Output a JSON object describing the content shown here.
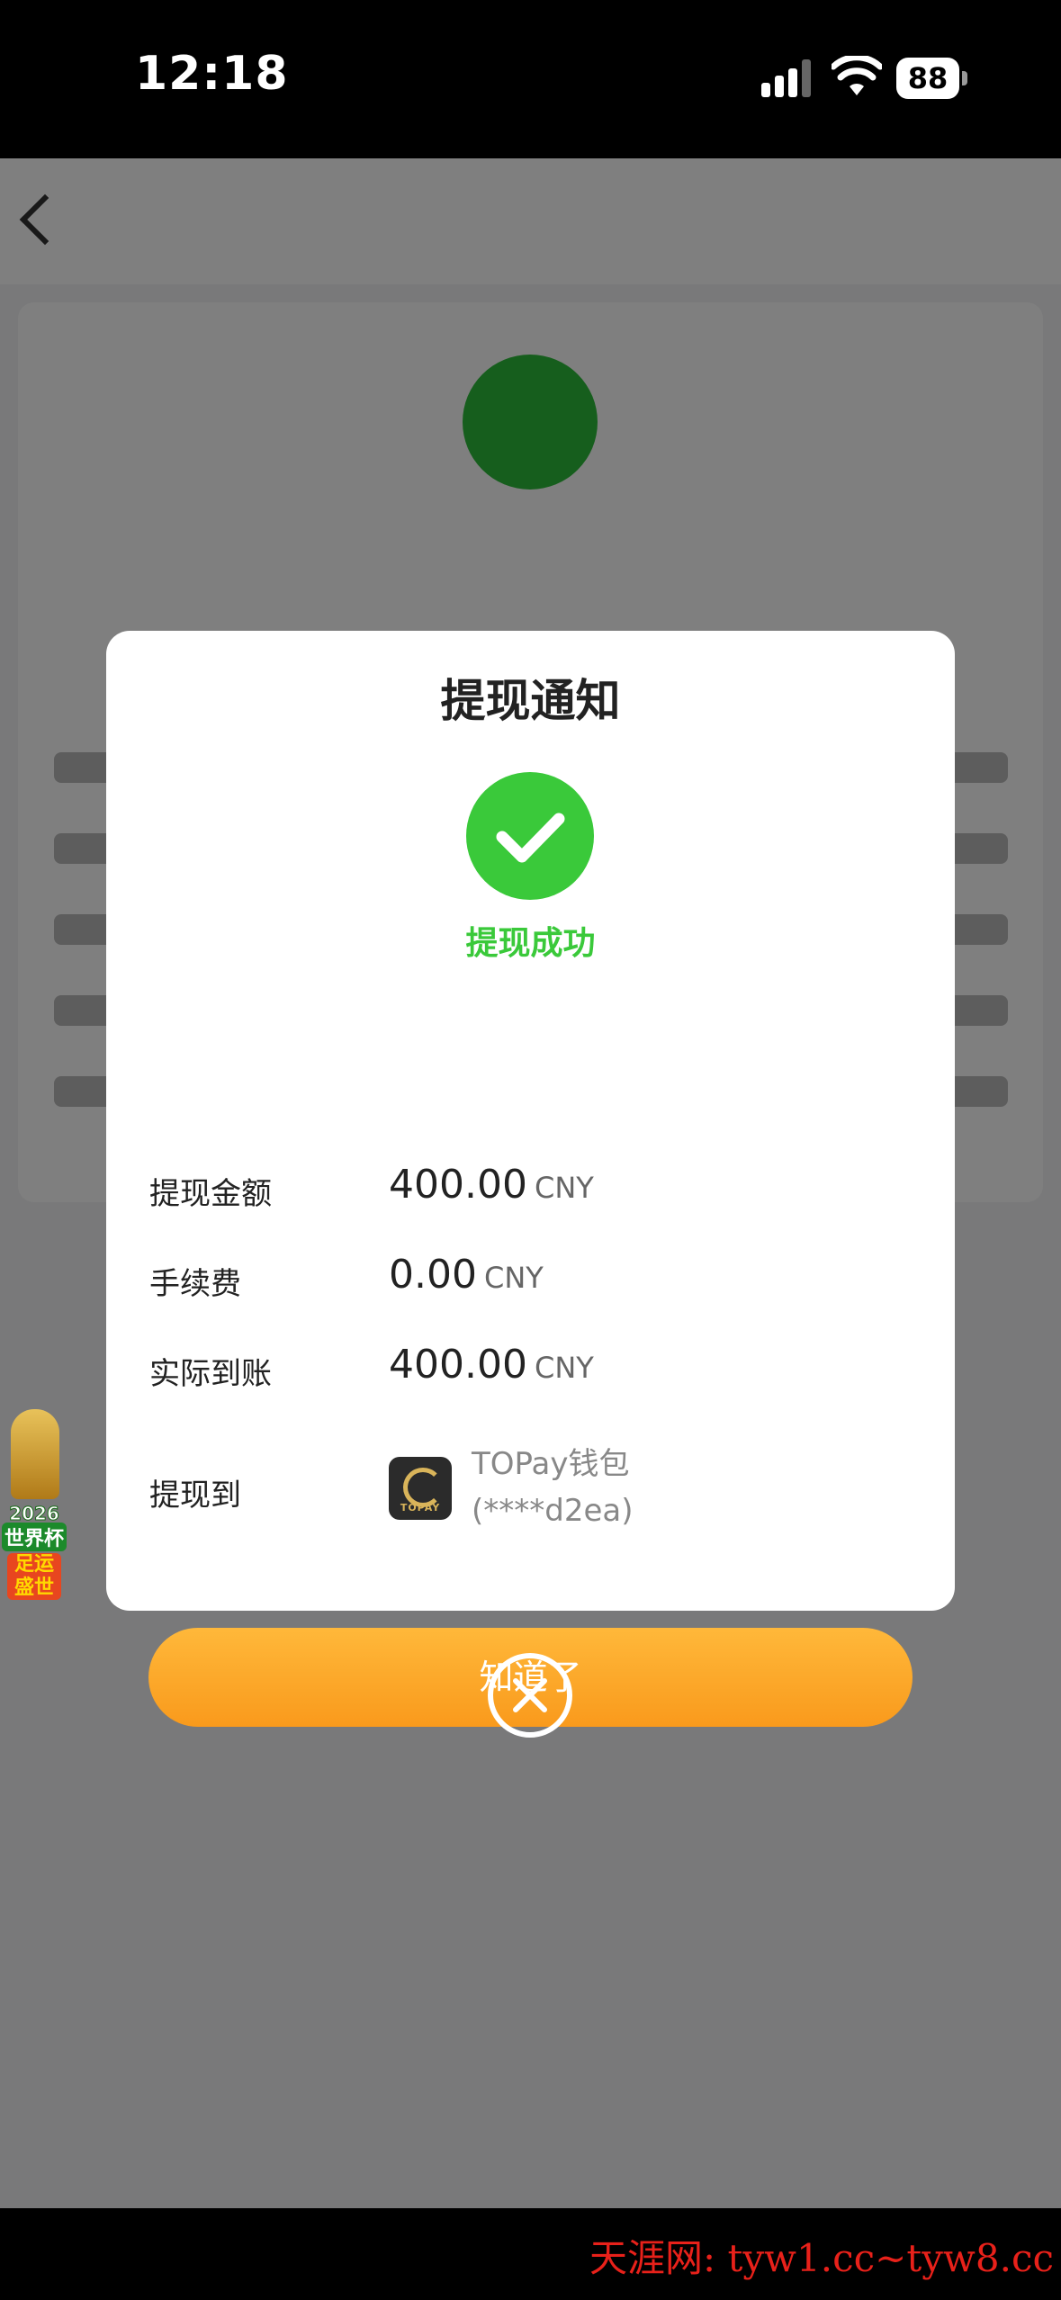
{
  "status_bar": {
    "time": "12:18",
    "battery": "88"
  },
  "modal": {
    "title": "提现通知",
    "status": "提现成功",
    "rows": [
      {
        "label": "提现金额",
        "value": "400.00",
        "unit": "CNY"
      },
      {
        "label": "手续费",
        "value": "0.00",
        "unit": "CNY"
      },
      {
        "label": "实际到账",
        "value": "400.00",
        "unit": "CNY"
      }
    ],
    "withdraw_to": {
      "label": "提现到",
      "wallet_name": "TOPay钱包",
      "account": "(****d2ea)",
      "logo_text": "TOPAY"
    },
    "confirm_label": "知道了"
  },
  "float_badge": {
    "year": "2026",
    "title": "世界杯",
    "slogan_line1": "足运",
    "slogan_line2": "盛世"
  },
  "watermark": "天涯网: tyw1.cc~tyw8.cc",
  "colors": {
    "success": "#3ac93a",
    "button_top": "#ffb83a",
    "button_bottom": "#f99a1c"
  },
  "icons": {
    "success": "check-circle-icon",
    "close": "close-circle-icon"
  }
}
